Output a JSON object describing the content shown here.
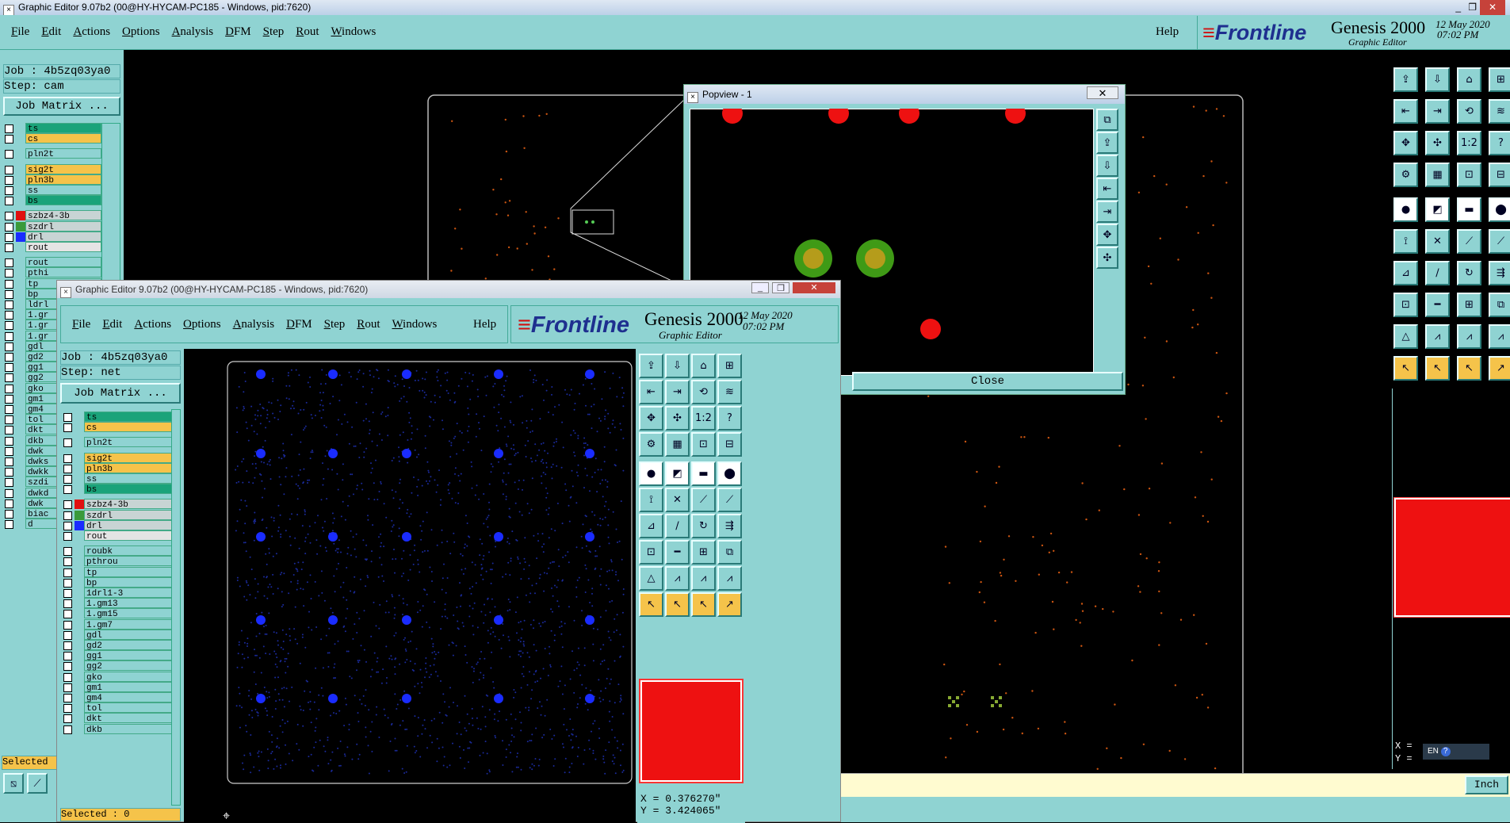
{
  "main": {
    "title": "Graphic Editor 9.07b2 (00@HY-HYCAM-PC185 - Windows, pid:7620)",
    "menu": [
      "File",
      "Edit",
      "Actions",
      "Options",
      "Analysis",
      "DFM",
      "Step",
      "Rout",
      "Windows"
    ],
    "help": "Help",
    "logo": "Frontline",
    "product": "Genesis 2000",
    "subtitle": "Graphic Editor",
    "date": "12 May 2020",
    "time": "07:02 PM",
    "job": "Job : 4b5zq03ya0",
    "step": "Step: cam",
    "job_matrix": "Job Matrix ...",
    "layers": [
      "ts",
      "cs",
      "pln2t",
      "sig2t",
      "pln3b",
      "ss",
      "bs",
      "szbz4-3b",
      "szdrl",
      "drl",
      "rout",
      "rout",
      "pthi",
      "tp",
      "bp",
      "ldrl",
      "1.gr",
      "1.gr",
      "1.gr",
      "gdl",
      "gd2",
      "gg1",
      "gg2",
      "gko",
      "gm1",
      "gm4",
      "tol",
      "dkt",
      "dkb",
      "dwk",
      "dwks",
      "dwkk",
      "szdi",
      "dwkd",
      "dwk",
      "biac",
      "d"
    ],
    "selected": "Selected",
    "coord_x": "X =",
    "coord_y": "Y =",
    "units": "Inch",
    "lang": "EN"
  },
  "popview": {
    "title": "Popview - 1",
    "close": "Close"
  },
  "second": {
    "title": "Graphic Editor 9.07b2 (00@HY-HYCAM-PC185 - Windows, pid:7620)",
    "menu": [
      "File",
      "Edit",
      "Actions",
      "Options",
      "Analysis",
      "DFM",
      "Step",
      "Rout",
      "Windows"
    ],
    "help": "Help",
    "logo": "Frontline",
    "product": "Genesis 2000",
    "subtitle": "Graphic Editor",
    "date": "12 May 2020",
    "time": "07:02 PM",
    "job": "Job : 4b5zq03ya0",
    "step": "Step: net",
    "job_matrix": "Job Matrix ...",
    "layers": [
      "ts",
      "cs",
      "pln2t",
      "sig2t",
      "pln3b",
      "ss",
      "bs",
      "szbz4-3b",
      "szdrl",
      "drl",
      "rout",
      "roubk",
      "pthrou",
      "tp",
      "bp",
      "1drl1-3",
      "1.gm13",
      "1.gm15",
      "1.gm7",
      "gdl",
      "gd2",
      "gg1",
      "gg2",
      "gko",
      "gm1",
      "gm4",
      "tol",
      "dkt",
      "dkb"
    ],
    "selected": "Selected : 0",
    "x": "X = 0.376270\"",
    "y": "Y = 3.424065\""
  },
  "colors": {
    "teal": "#8fd3d2",
    "signal_yellow": "#f5c34a",
    "mask_green": "#1aa37a",
    "drill_red": "#e01010",
    "net_blue": "#1a2cff"
  }
}
